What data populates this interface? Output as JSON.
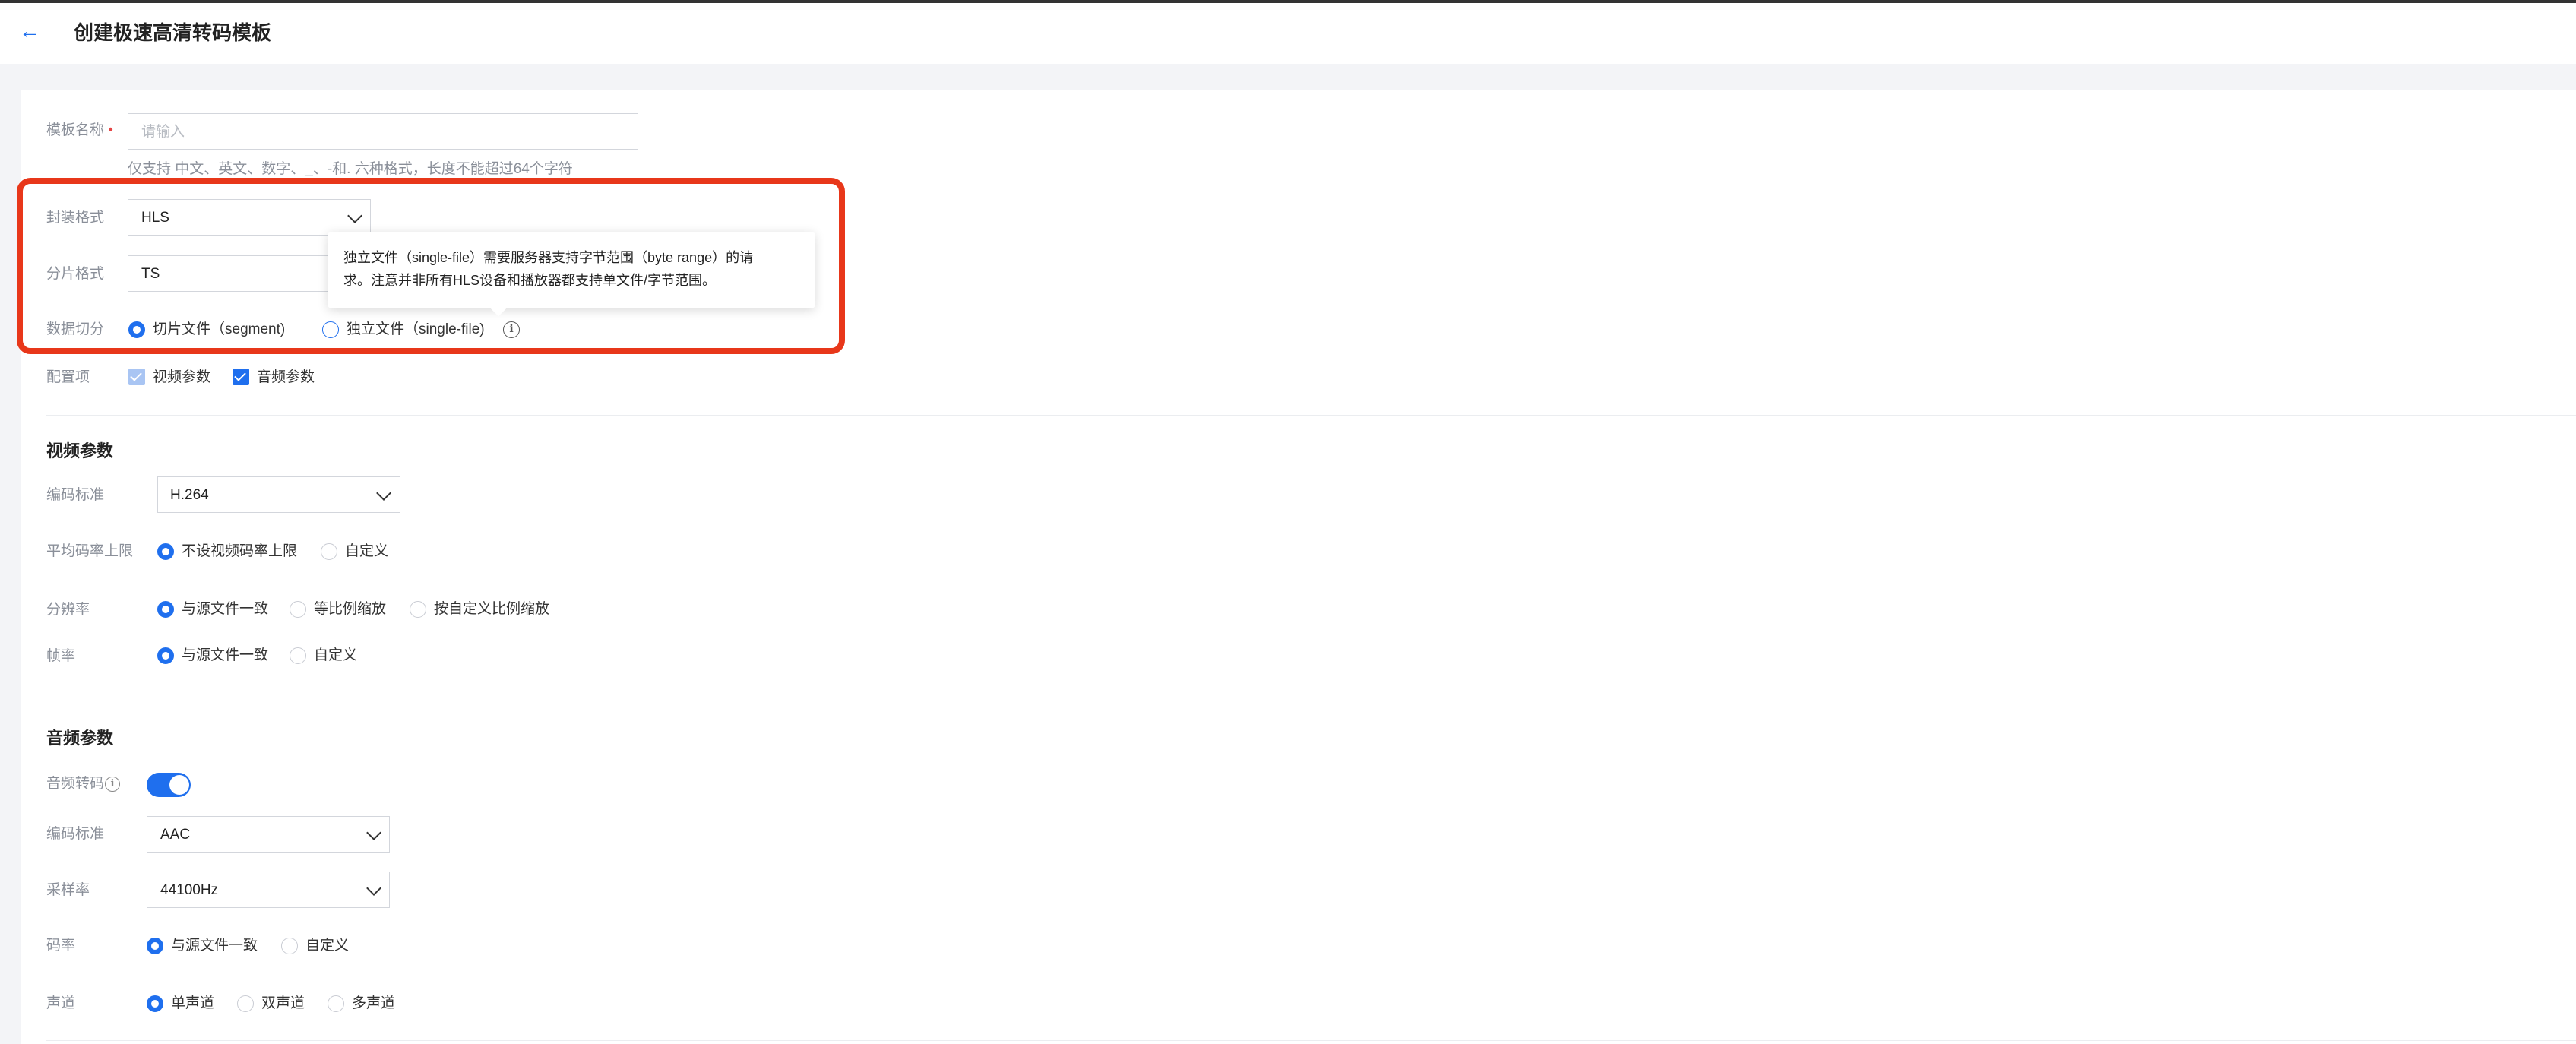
{
  "header": {
    "title": "创建极速高清转码模板"
  },
  "form": {
    "template_name": {
      "label": "模板名称",
      "placeholder": "请输入",
      "hint": "仅支持 中文、英文、数字、_、-和. 六种格式，长度不能超过64个字符"
    },
    "container": {
      "label": "封装格式",
      "value": "HLS"
    },
    "segment_format": {
      "label": "分片格式",
      "value": "TS"
    },
    "data_split": {
      "label": "数据切分",
      "options": [
        "切片文件（segment)",
        "独立文件（single-file)"
      ],
      "selected": "切片文件（segment)"
    },
    "config": {
      "label": "配置项",
      "options": [
        "视频参数",
        "音频参数"
      ]
    }
  },
  "tooltip": {
    "line1": "独立文件（single-file）需要服务器支持字节范围（byte range）的请",
    "line2": "求。注意并非所有HLS设备和播放器都支持单文件/字节范围。"
  },
  "video": {
    "title": "视频参数",
    "codec": {
      "label": "编码标准",
      "value": "H.264"
    },
    "bitrate": {
      "label": "平均码率上限",
      "options": [
        "不设视频码率上限",
        "自定义"
      ],
      "selected": "不设视频码率上限"
    },
    "resolution": {
      "label": "分辨率",
      "options": [
        "与源文件一致",
        "等比例缩放",
        "按自定义比例缩放"
      ],
      "selected": "与源文件一致"
    },
    "framerate": {
      "label": "帧率",
      "options": [
        "与源文件一致",
        "自定义"
      ],
      "selected": "与源文件一致"
    }
  },
  "audio": {
    "title": "音频参数",
    "transcode": {
      "label": "音频转码",
      "enabled": true
    },
    "codec": {
      "label": "编码标准",
      "value": "AAC"
    },
    "sample_rate": {
      "label": "采样率",
      "value": "44100Hz"
    },
    "bitrate": {
      "label": "码率",
      "options": [
        "与源文件一致",
        "自定义"
      ],
      "selected": "与源文件一致"
    },
    "channels": {
      "label": "声道",
      "options": [
        "单声道",
        "双声道",
        "多声道"
      ],
      "selected": "单声道"
    }
  },
  "colors": {
    "accent": "#1f6fee",
    "highlight": "#e8371a"
  }
}
